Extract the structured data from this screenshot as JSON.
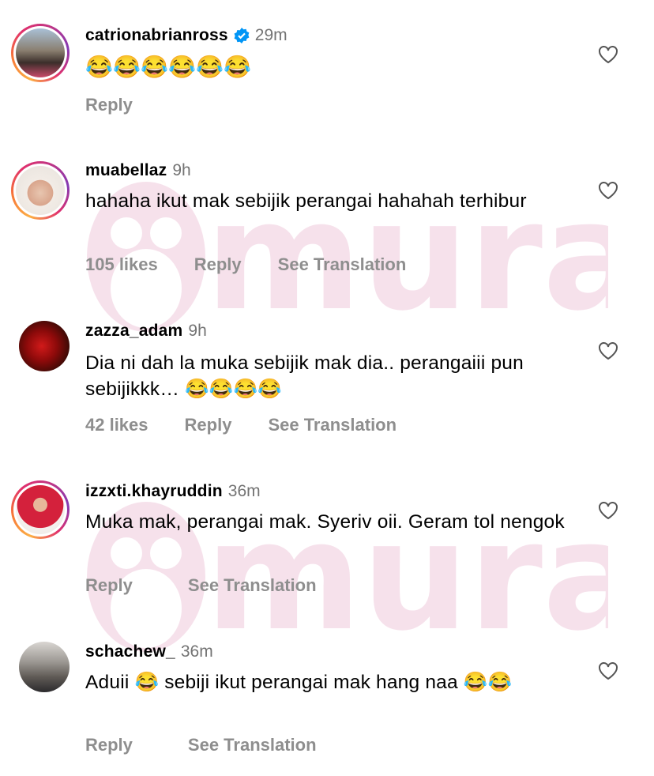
{
  "comments": [
    {
      "username": "catrionabrianross",
      "verified": true,
      "time": "29m",
      "text": "😂😂😂😂😂😂",
      "likes": "",
      "reply": "Reply",
      "translate": ""
    },
    {
      "username": "muabellaz",
      "verified": false,
      "time": "9h",
      "text": "hahaha ikut  mak sebijik perangai hahahah terhibur",
      "likes": "105 likes",
      "reply": "Reply",
      "translate": "See Translation"
    },
    {
      "username": "zazza_adam",
      "verified": false,
      "time": "9h",
      "text": "Dia ni dah la muka sebijik mak dia.. perangaiii pun sebijikkk… 😂😂😂😂",
      "likes": "42 likes",
      "reply": "Reply",
      "translate": "See Translation"
    },
    {
      "username": "izzxti.khayruddin",
      "verified": false,
      "time": "36m",
      "text": "Muka mak, perangai mak. Syeriv oii. Geram tol nengok",
      "likes": "",
      "reply": "Reply",
      "translate": "See Translation"
    },
    {
      "username": "schachew_",
      "verified": false,
      "time": "36m",
      "text": "Aduii 😂 sebiji ikut perangai mak hang naa 😂😂",
      "likes": "",
      "reply": "Reply",
      "translate": "See Translation"
    }
  ],
  "watermark": {
    "text": "murai"
  },
  "colors": {
    "secondary_text": "#737373",
    "action_text": "#8e8e8e",
    "verified_blue": "#0095f6"
  },
  "icons": [
    "heart-icon",
    "verified-badge-icon"
  ]
}
